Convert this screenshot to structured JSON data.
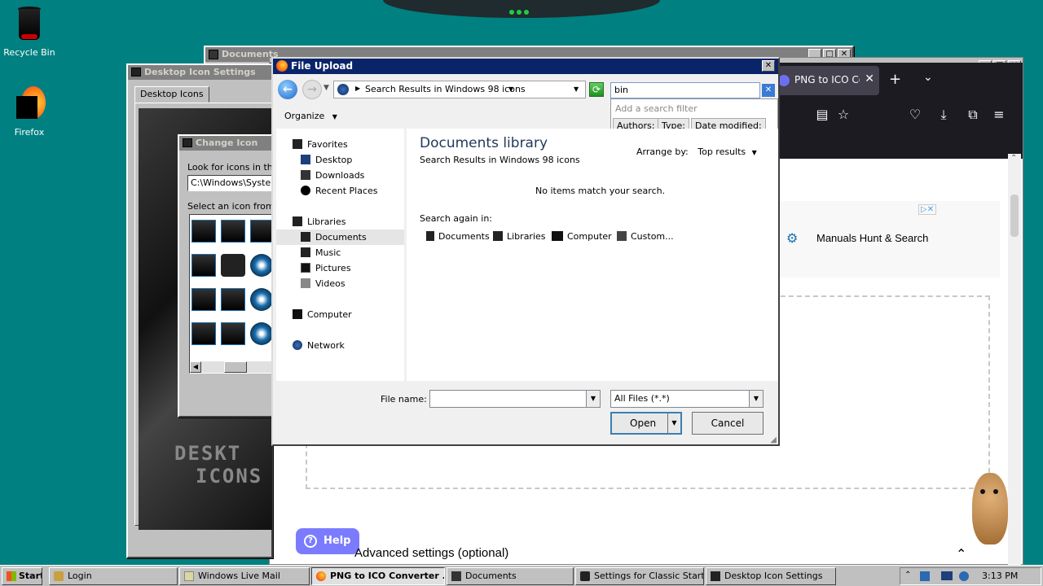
{
  "desktop": {
    "icons": [
      {
        "label": "Recycle Bin",
        "icon": "recycle-bin-icon"
      },
      {
        "label": "Firefox",
        "icon": "firefox-icon"
      }
    ]
  },
  "documents_window": {
    "title": "Documents"
  },
  "desktop_icon_settings": {
    "title": "Desktop Icon Settings",
    "tab": "Desktop Icons",
    "branding_line1": "DESKT",
    "branding_line2": "ICONS"
  },
  "change_icon": {
    "title": "Change Icon",
    "look_label": "Look for icons in this",
    "path_value": "C:\\Windows\\Syster",
    "select_label": "Select an icon from t"
  },
  "firefox": {
    "tab_title": "PNG to ICO Conv",
    "ad_text": "Manuals Hunt & Search",
    "help_label": "Help",
    "advanced_settings": "Advanced settings (optional)"
  },
  "file_upload": {
    "title": "File Upload",
    "breadcrumb": "Search Results in Windows 98 icons",
    "search_value": "bin",
    "filter_hint": "Add a search filter",
    "filters": [
      "Authors:",
      "Type:",
      "Date modified:"
    ],
    "organize": "Organize",
    "nav": {
      "favorites": "Favorites",
      "desktop": "Desktop",
      "downloads": "Downloads",
      "recent_places": "Recent Places",
      "libraries": "Libraries",
      "documents": "Documents",
      "music": "Music",
      "pictures": "Pictures",
      "videos": "Videos",
      "computer": "Computer",
      "network": "Network"
    },
    "library_title": "Documents library",
    "library_subtitle": "Search Results in Windows 98 icons",
    "arrange_label": "Arrange by:",
    "arrange_value": "Top results",
    "no_items": "No items match your search.",
    "search_again": "Search again in:",
    "search_again_items": [
      "Documents",
      "Libraries",
      "Computer",
      "Custom..."
    ],
    "file_name_label": "File name:",
    "file_name_value": "",
    "file_type": "All Files (*.*)",
    "open_label": "Open",
    "cancel_label": "Cancel"
  },
  "taskbar": {
    "start": "Start",
    "items": [
      {
        "label": "Login",
        "active": false
      },
      {
        "label": "Windows Live Mail",
        "active": false
      },
      {
        "label": "PNG to ICO Converter ...",
        "active": true
      },
      {
        "label": "Documents",
        "active": false
      },
      {
        "label": "Settings for Classic Start...",
        "active": false
      },
      {
        "label": "Desktop Icon Settings",
        "active": false
      }
    ],
    "time": "3:13 PM"
  },
  "colors": {
    "desktop": "#008080",
    "titlebar_active": "#0a246a",
    "firefox_dark": "#1c1b22",
    "help_button": "#7b7bff"
  }
}
